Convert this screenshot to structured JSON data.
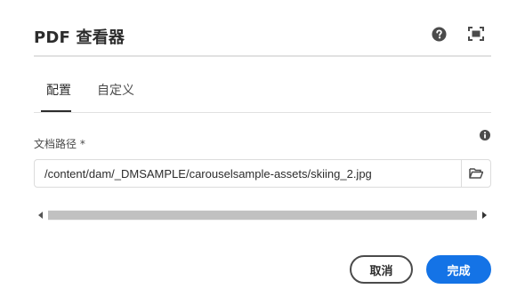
{
  "dialog": {
    "title": "PDF 查看器",
    "icons": {
      "help": "help-icon",
      "fullscreen": "fullscreen-icon",
      "info": "info-icon",
      "browse": "folder-icon"
    }
  },
  "tabs": [
    {
      "label": "配置",
      "active": true
    },
    {
      "label": "自定义",
      "active": false
    }
  ],
  "form": {
    "document_path": {
      "label": "文档路径 *",
      "value": "/content/dam/_DMSAMPLE/carouselsample-assets/skiing_2.jpg"
    }
  },
  "footer": {
    "cancel_label": "取消",
    "done_label": "完成"
  },
  "colors": {
    "accent": "#1473e6",
    "text": "#2c2c2c",
    "divider": "#e1e1e1"
  }
}
